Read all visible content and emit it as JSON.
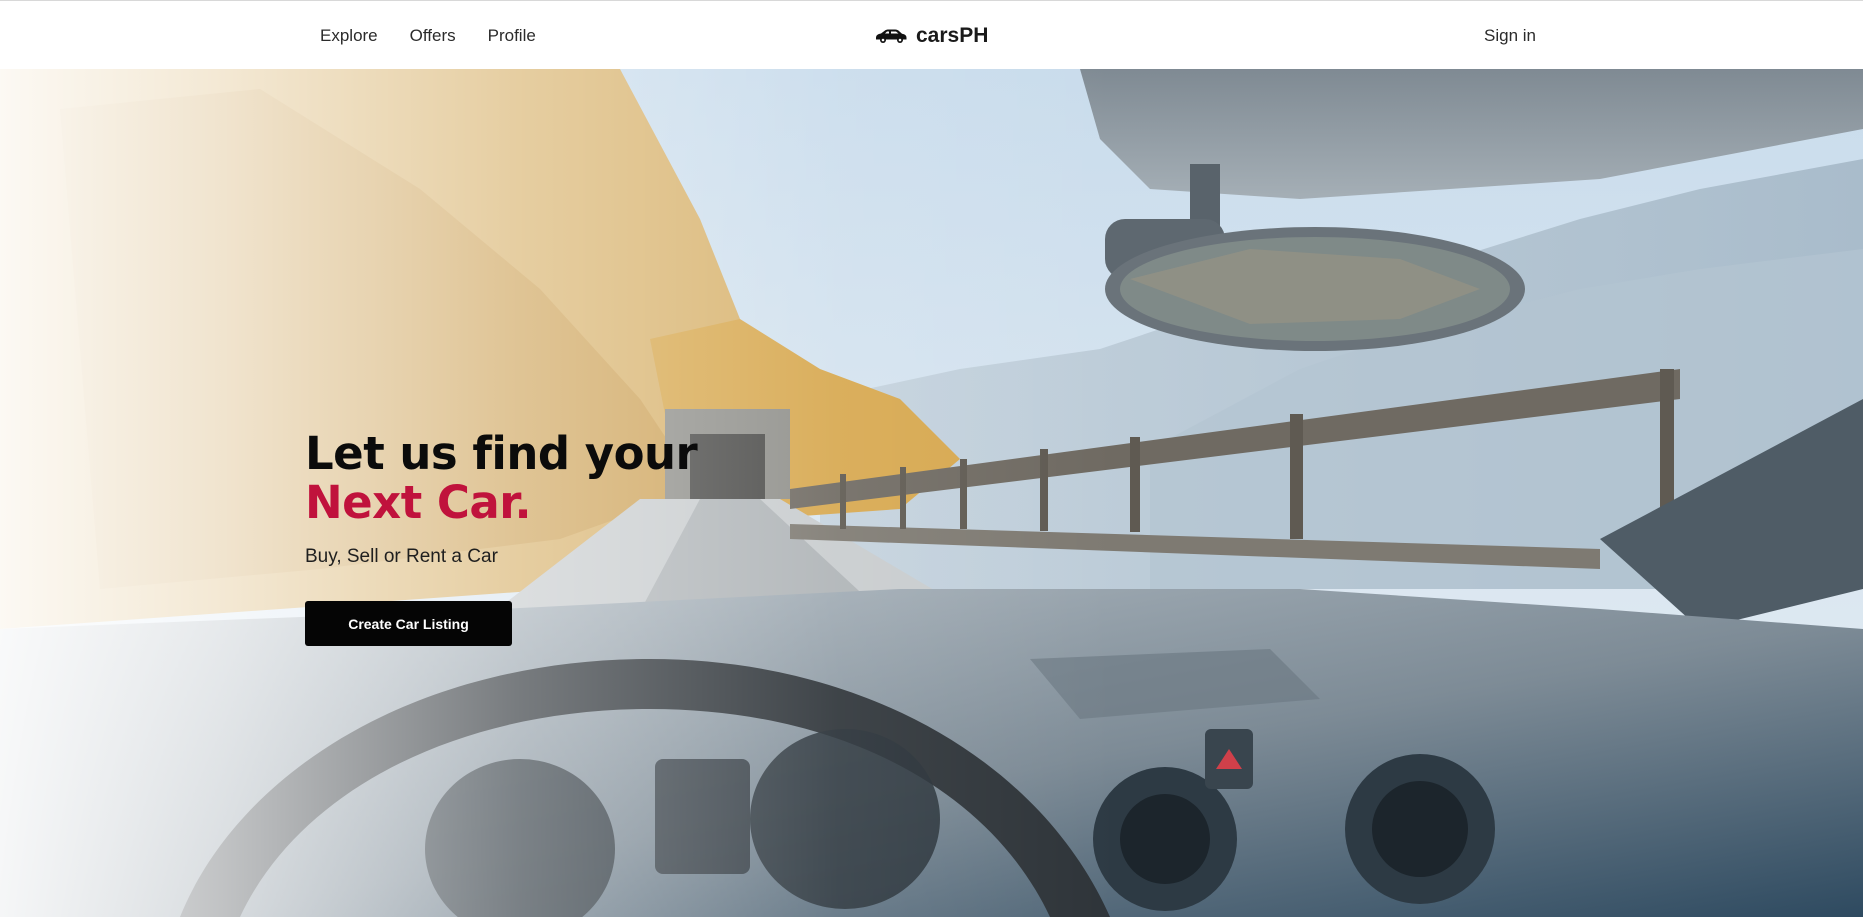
{
  "nav": {
    "links": [
      "Explore",
      "Offers",
      "Profile"
    ],
    "brand": "carsPH",
    "brand_icon": "car-icon",
    "sign_in": "Sign in"
  },
  "hero": {
    "headline_line1": "Let us find your",
    "headline_line2": "Next Car.",
    "subtitle": "Buy, Sell or Rent a Car",
    "cta_label": "Create Car Listing",
    "accent_color": "#c0123c",
    "background": "car-interior-road-photo"
  }
}
